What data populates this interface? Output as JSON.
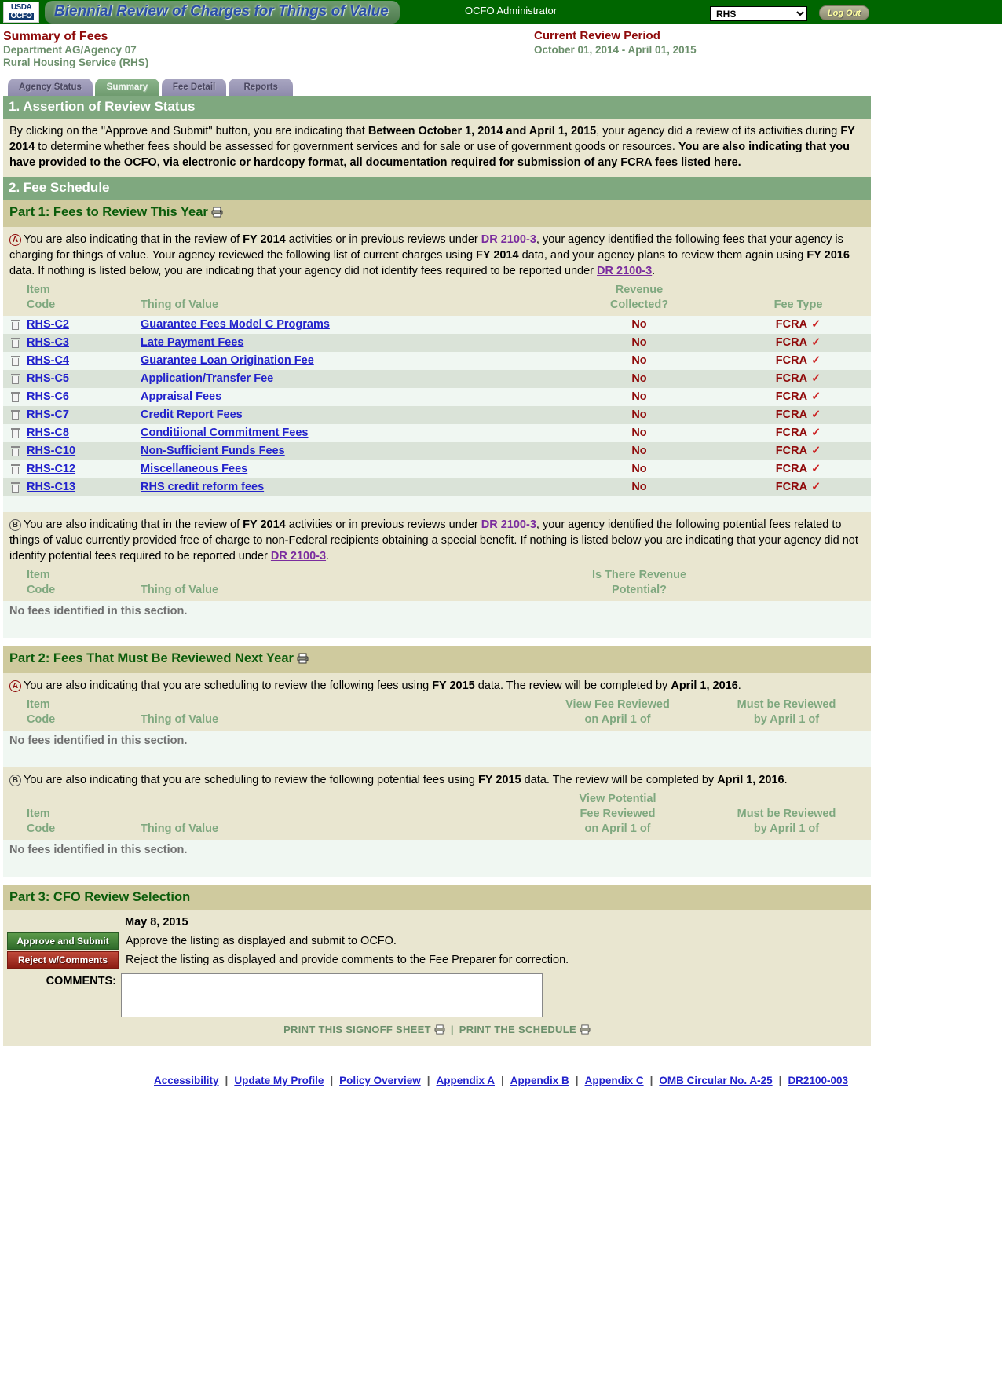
{
  "header": {
    "logo_line1": "USDA",
    "logo_line2": "OCFO",
    "app_title": "Biennial Review of Charges for Things of Value",
    "admin_label": "OCFO Administrator",
    "agency_selected": "RHS",
    "agency_options": [
      "RHS"
    ],
    "logout_label": "Log Out"
  },
  "summary": {
    "title": "Summary of Fees",
    "department": "Department AG/Agency 07",
    "agency": "Rural Housing Service (RHS)",
    "period_title": "Current Review Period",
    "period_range": "October 01, 2014 - April 01, 2015"
  },
  "tabs": [
    {
      "label": "Agency Status",
      "active": false
    },
    {
      "label": "Summary",
      "active": true
    },
    {
      "label": "Fee Detail",
      "active": false
    },
    {
      "label": "Reports",
      "active": false
    }
  ],
  "section1": {
    "bar": "1. Assertion of Review Status",
    "text_1": "By clicking on the \"Approve and Submit\" button, you are indicating that ",
    "bold_1": "Between October 1, 2014 and April 1, 2015",
    "text_2": ", your agency did a review of its activities during ",
    "bold_2": "FY 2014",
    "text_3": " to determine whether fees should be assessed for government services and for sale or use of government goods or resources. ",
    "bold_3": "You are also indicating that you have provided to the OCFO, via electronic or hardcopy format, all documentation required for submission of any FCRA fees listed here."
  },
  "section2": {
    "bar": "2. Fee Schedule"
  },
  "part1": {
    "title": "Part 1: Fees to Review This Year",
    "a": {
      "marker": "A",
      "t1": "You are also indicating that in the review of ",
      "b1": "FY 2014",
      "t2": " activities or in previous reviews under ",
      "link1": "DR 2100-3",
      "t3": ", your agency identified the following fees that your agency is charging for things of value. Your agency reviewed the following list of current charges using ",
      "b2": "FY 2014",
      "t4": " data, and your agency plans to review them again using ",
      "b3": "FY 2016",
      "t5": " data. If nothing is listed below, you are indicating that your agency did not identify fees required to be reported under ",
      "link2": "DR 2100-3",
      "t6": "."
    },
    "columns": {
      "item": "Item",
      "code": "Code",
      "thing": "Thing of Value",
      "revenue_l1": "Revenue",
      "revenue_l2": "Collected?",
      "fee_type": "Fee Type"
    },
    "rows": [
      {
        "code": "RHS-C2",
        "thing": "Guarantee Fees Model C Programs",
        "revenue": "No",
        "fee_type": "FCRA",
        "check": "✓"
      },
      {
        "code": "RHS-C3",
        "thing": "Late Payment Fees",
        "revenue": "No",
        "fee_type": "FCRA",
        "check": "✓"
      },
      {
        "code": "RHS-C4",
        "thing": "Guarantee Loan Origination Fee",
        "revenue": "No",
        "fee_type": "FCRA",
        "check": "✓"
      },
      {
        "code": "RHS-C5",
        "thing": "Application/Transfer Fee",
        "revenue": "No",
        "fee_type": "FCRA",
        "check": "✓"
      },
      {
        "code": "RHS-C6",
        "thing": "Appraisal Fees",
        "revenue": "No",
        "fee_type": "FCRA",
        "check": "✓"
      },
      {
        "code": "RHS-C7",
        "thing": "Credit Report Fees",
        "revenue": "No",
        "fee_type": "FCRA",
        "check": "✓"
      },
      {
        "code": "RHS-C8",
        "thing": "Conditiional Commitment Fees",
        "revenue": "No",
        "fee_type": "FCRA",
        "check": "✓"
      },
      {
        "code": "RHS-C10",
        "thing": "Non-Sufficient Funds Fees",
        "revenue": "No",
        "fee_type": "FCRA",
        "check": "✓"
      },
      {
        "code": "RHS-C12",
        "thing": "Miscellaneous Fees",
        "revenue": "No",
        "fee_type": "FCRA",
        "check": "✓"
      },
      {
        "code": "RHS-C13",
        "thing": "RHS credit reform fees",
        "revenue": "No",
        "fee_type": "FCRA",
        "check": "✓"
      }
    ],
    "b": {
      "marker": "B",
      "t1": "You are also indicating that in the review of ",
      "b1": "FY 2014",
      "t2": " activities or in previous reviews under ",
      "link1": "DR 2100-3",
      "t3": ", your agency identified the following potential fees related to things of value currently provided free of charge to non-Federal recipients obtaining a special benefit. If nothing is listed below you are indicating that your agency did not identify potential fees required to be reported under ",
      "link2": "DR 2100-3",
      "t4": ".",
      "columns": {
        "item": "Item",
        "code": "Code",
        "thing": "Thing of Value",
        "potential_l1": "Is There Revenue",
        "potential_l2": "Potential?"
      },
      "empty": "No fees identified in this section."
    }
  },
  "part2": {
    "title": "Part 2: Fees That Must Be Reviewed Next Year",
    "a": {
      "marker": "A",
      "t1": "You are also indicating that you are scheduling to review the following fees using ",
      "b1": "FY 2015",
      "t2": " data. The review will be completed by ",
      "b2": "April 1, 2016",
      "t3": ".",
      "columns": {
        "item": "Item",
        "code": "Code",
        "thing": "Thing of Value",
        "view_l1": "View Fee Reviewed",
        "view_l2": "on April 1 of",
        "must_l1": "Must be Reviewed",
        "must_l2": "by April 1 of"
      },
      "empty": "No fees identified in this section."
    },
    "b": {
      "marker": "B",
      "t1": "You are also indicating that you are scheduling to review the following potential fees using ",
      "b1": "FY 2015",
      "t2": " data. The review will be completed by ",
      "b2": "April 1, 2016",
      "t3": ".",
      "columns": {
        "item": "Item",
        "code": "Code",
        "thing": "Thing of Value",
        "view_l1": "View Potential",
        "view_l2": "Fee Reviewed",
        "view_l3": "on April 1 of",
        "must_l1": "Must be Reviewed",
        "must_l2": "by April 1 of"
      },
      "empty": "No fees identified in this section."
    }
  },
  "part3": {
    "title": "Part 3: CFO Review Selection",
    "date": "May 8, 2015",
    "approve_button": "Approve and Submit",
    "approve_text": "Approve the listing as displayed and submit to OCFO.",
    "reject_button": "Reject w/Comments",
    "reject_text": "Reject the listing as displayed and provide comments to the Fee Preparer for correction.",
    "comments_label": "COMMENTS:",
    "comments_value": "",
    "print_signoff": "PRINT THIS SIGNOFF SHEET",
    "print_schedule": "PRINT THE SCHEDULE"
  },
  "footer": {
    "links": [
      "Accessibility",
      "Update My Profile",
      "Policy Overview",
      "Appendix A",
      "Appendix B",
      "Appendix C",
      "OMB Circular No. A-25",
      "DR2100-003"
    ]
  },
  "colors": {
    "header_green": "#006600",
    "section_bar": "#7fa87f",
    "part_bar": "#cfca9e",
    "panel_tan": "#e9e6d0",
    "row_odd": "#f0f7f2",
    "row_even": "#dae3d8",
    "link_blue": "#2222cc",
    "link_purple": "#7a2c9e",
    "dark_red": "#8f0a0a"
  }
}
